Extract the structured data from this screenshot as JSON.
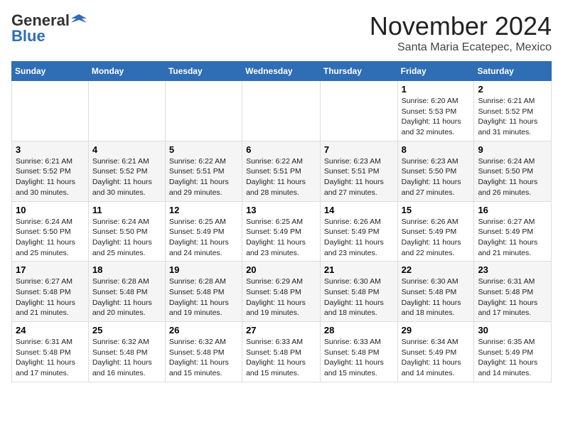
{
  "logo": {
    "general": "General",
    "blue": "Blue"
  },
  "header": {
    "month_title": "November 2024",
    "location": "Santa Maria Ecatepec, Mexico"
  },
  "weekdays": [
    "Sunday",
    "Monday",
    "Tuesday",
    "Wednesday",
    "Thursday",
    "Friday",
    "Saturday"
  ],
  "weeks": [
    [
      {
        "day": "",
        "info": ""
      },
      {
        "day": "",
        "info": ""
      },
      {
        "day": "",
        "info": ""
      },
      {
        "day": "",
        "info": ""
      },
      {
        "day": "",
        "info": ""
      },
      {
        "day": "1",
        "info": "Sunrise: 6:20 AM\nSunset: 5:53 PM\nDaylight: 11 hours and 32 minutes."
      },
      {
        "day": "2",
        "info": "Sunrise: 6:21 AM\nSunset: 5:52 PM\nDaylight: 11 hours and 31 minutes."
      }
    ],
    [
      {
        "day": "3",
        "info": "Sunrise: 6:21 AM\nSunset: 5:52 PM\nDaylight: 11 hours and 30 minutes."
      },
      {
        "day": "4",
        "info": "Sunrise: 6:21 AM\nSunset: 5:52 PM\nDaylight: 11 hours and 30 minutes."
      },
      {
        "day": "5",
        "info": "Sunrise: 6:22 AM\nSunset: 5:51 PM\nDaylight: 11 hours and 29 minutes."
      },
      {
        "day": "6",
        "info": "Sunrise: 6:22 AM\nSunset: 5:51 PM\nDaylight: 11 hours and 28 minutes."
      },
      {
        "day": "7",
        "info": "Sunrise: 6:23 AM\nSunset: 5:51 PM\nDaylight: 11 hours and 27 minutes."
      },
      {
        "day": "8",
        "info": "Sunrise: 6:23 AM\nSunset: 5:50 PM\nDaylight: 11 hours and 27 minutes."
      },
      {
        "day": "9",
        "info": "Sunrise: 6:24 AM\nSunset: 5:50 PM\nDaylight: 11 hours and 26 minutes."
      }
    ],
    [
      {
        "day": "10",
        "info": "Sunrise: 6:24 AM\nSunset: 5:50 PM\nDaylight: 11 hours and 25 minutes."
      },
      {
        "day": "11",
        "info": "Sunrise: 6:24 AM\nSunset: 5:50 PM\nDaylight: 11 hours and 25 minutes."
      },
      {
        "day": "12",
        "info": "Sunrise: 6:25 AM\nSunset: 5:49 PM\nDaylight: 11 hours and 24 minutes."
      },
      {
        "day": "13",
        "info": "Sunrise: 6:25 AM\nSunset: 5:49 PM\nDaylight: 11 hours and 23 minutes."
      },
      {
        "day": "14",
        "info": "Sunrise: 6:26 AM\nSunset: 5:49 PM\nDaylight: 11 hours and 23 minutes."
      },
      {
        "day": "15",
        "info": "Sunrise: 6:26 AM\nSunset: 5:49 PM\nDaylight: 11 hours and 22 minutes."
      },
      {
        "day": "16",
        "info": "Sunrise: 6:27 AM\nSunset: 5:49 PM\nDaylight: 11 hours and 21 minutes."
      }
    ],
    [
      {
        "day": "17",
        "info": "Sunrise: 6:27 AM\nSunset: 5:48 PM\nDaylight: 11 hours and 21 minutes."
      },
      {
        "day": "18",
        "info": "Sunrise: 6:28 AM\nSunset: 5:48 PM\nDaylight: 11 hours and 20 minutes."
      },
      {
        "day": "19",
        "info": "Sunrise: 6:28 AM\nSunset: 5:48 PM\nDaylight: 11 hours and 19 minutes."
      },
      {
        "day": "20",
        "info": "Sunrise: 6:29 AM\nSunset: 5:48 PM\nDaylight: 11 hours and 19 minutes."
      },
      {
        "day": "21",
        "info": "Sunrise: 6:30 AM\nSunset: 5:48 PM\nDaylight: 11 hours and 18 minutes."
      },
      {
        "day": "22",
        "info": "Sunrise: 6:30 AM\nSunset: 5:48 PM\nDaylight: 11 hours and 18 minutes."
      },
      {
        "day": "23",
        "info": "Sunrise: 6:31 AM\nSunset: 5:48 PM\nDaylight: 11 hours and 17 minutes."
      }
    ],
    [
      {
        "day": "24",
        "info": "Sunrise: 6:31 AM\nSunset: 5:48 PM\nDaylight: 11 hours and 17 minutes."
      },
      {
        "day": "25",
        "info": "Sunrise: 6:32 AM\nSunset: 5:48 PM\nDaylight: 11 hours and 16 minutes."
      },
      {
        "day": "26",
        "info": "Sunrise: 6:32 AM\nSunset: 5:48 PM\nDaylight: 11 hours and 15 minutes."
      },
      {
        "day": "27",
        "info": "Sunrise: 6:33 AM\nSunset: 5:48 PM\nDaylight: 11 hours and 15 minutes."
      },
      {
        "day": "28",
        "info": "Sunrise: 6:33 AM\nSunset: 5:48 PM\nDaylight: 11 hours and 15 minutes."
      },
      {
        "day": "29",
        "info": "Sunrise: 6:34 AM\nSunset: 5:49 PM\nDaylight: 11 hours and 14 minutes."
      },
      {
        "day": "30",
        "info": "Sunrise: 6:35 AM\nSunset: 5:49 PM\nDaylight: 11 hours and 14 minutes."
      }
    ]
  ]
}
